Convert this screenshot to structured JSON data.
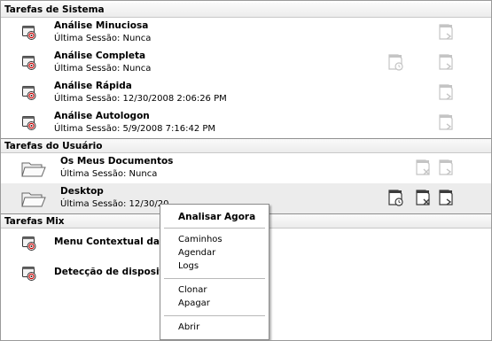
{
  "sections": {
    "system": "Tarefas de Sistema",
    "user": "Tarefas do Usuário",
    "mix": "Tarefas Mix"
  },
  "system_tasks": [
    {
      "name": "Análise Minuciosa",
      "session": "Última Sessão: Nunca"
    },
    {
      "name": "Análise Completa",
      "session": "Última Sessão: Nunca"
    },
    {
      "name": "Análise Rápida",
      "session": "Última Sessão: 12/30/2008 2:06:26 PM"
    },
    {
      "name": "Análise Autologon",
      "session": "Última Sessão: 5/9/2008 7:16:42 PM"
    }
  ],
  "user_tasks": [
    {
      "name": "Os Meus Documentos",
      "session": "Última Sessão: Nunca"
    },
    {
      "name": "Desktop",
      "session": "Última Sessão: 12/30/20"
    }
  ],
  "mix_tasks": [
    {
      "name": "Menu Contextual da A"
    },
    {
      "name": "Detecção de dispositiv"
    }
  ],
  "context_menu": {
    "scan_now": "Analisar Agora",
    "paths": "Caminhos",
    "schedule": "Agendar",
    "logs": "Logs",
    "clone": "Clonar",
    "delete": "Apagar",
    "open": "Abrir"
  },
  "icons": {
    "task": "scanner-task-icon",
    "folder": "folder-icon",
    "schedule": "schedule-icon",
    "delete": "delete-task-icon",
    "run": "run-task-icon"
  },
  "colors": {
    "section_bg": "#ececec",
    "selected_row": "#ececec",
    "disabled_icon": "#c4c4c4",
    "enabled_icon": "#3c3c3c"
  }
}
